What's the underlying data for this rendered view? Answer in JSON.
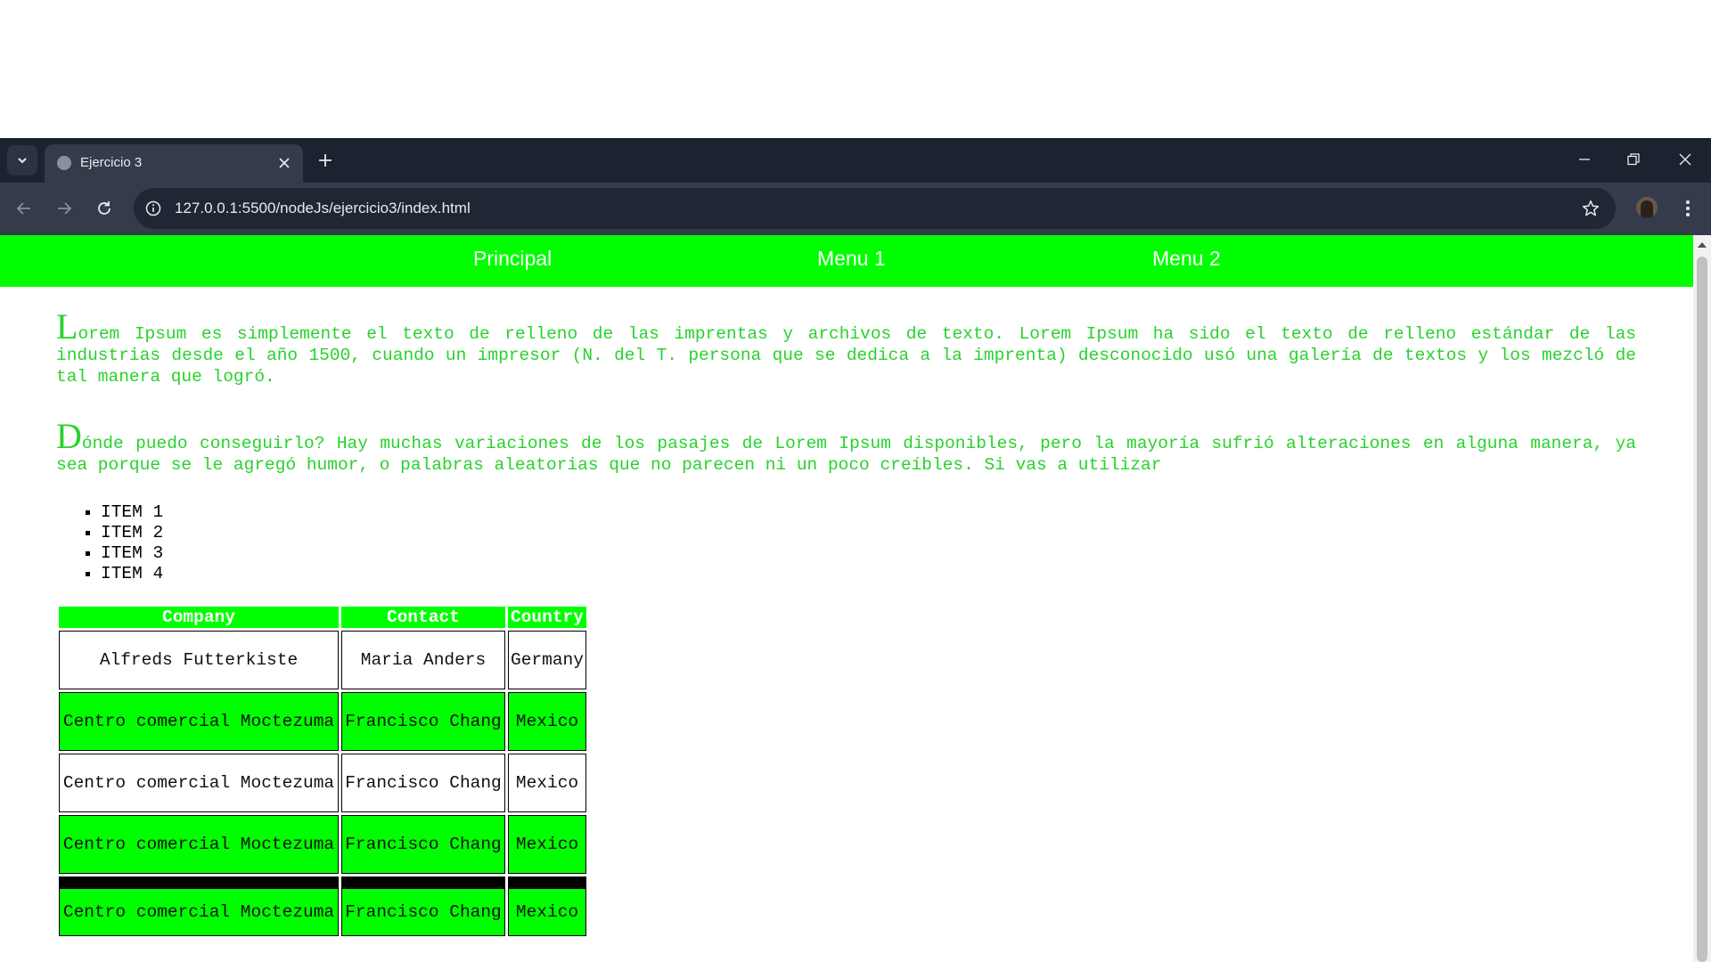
{
  "browser": {
    "tab_title": "Ejercicio 3",
    "url": "127.0.0.1:5500/nodeJs/ejercicio3/index.html"
  },
  "nav": {
    "links": [
      "Principal",
      "Menu 1",
      "Menu 2"
    ],
    "background": "#00ff00"
  },
  "content": {
    "paragraphs": [
      "Lorem Ipsum es simplemente el texto de relleno de las imprentas y archivos de texto. Lorem Ipsum ha sido el texto de relleno estándar de las industrias desde el año 1500, cuando un impresor (N. del T. persona que se dedica a la imprenta) desconocido usó una galería de textos y los mezcló de tal manera que logró.",
      "Dónde puedo conseguirlo? Hay muchas variaciones de los pasajes de Lorem Ipsum disponibles, pero la mayoría sufrió alteraciones en alguna manera, ya sea porque se le agregó humor, o palabras aleatorias que no parecen ni un poco creíbles. Si vas a utilizar"
    ],
    "paragraph_color": "#28d22c",
    "list_items": [
      "ITEM 1",
      "ITEM 2",
      "ITEM 3",
      "ITEM 4"
    ]
  },
  "table": {
    "headers": [
      "Company",
      "Contact",
      "Country"
    ],
    "rows": [
      [
        "Alfreds Futterkiste",
        "Maria Anders",
        "Germany"
      ],
      [
        "Centro comercial Moctezuma",
        "Francisco Chang",
        "Mexico"
      ],
      [
        "Centro comercial Moctezuma",
        "Francisco Chang",
        "Mexico"
      ],
      [
        "Centro comercial Moctezuma",
        "Francisco Chang",
        "Mexico"
      ],
      [
        "Centro comercial Moctezuma",
        "Francisco Chang",
        "Mexico"
      ]
    ]
  }
}
